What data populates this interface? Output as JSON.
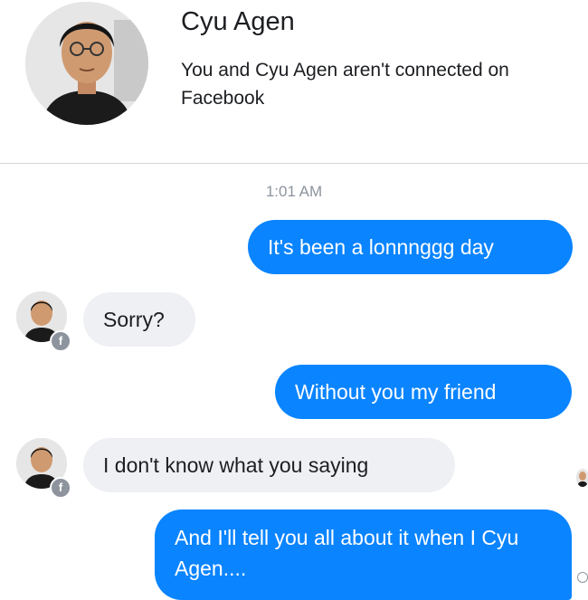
{
  "header": {
    "name": "Cyu Agen",
    "subtitle": "You and Cyu Agen aren't connected on Facebook"
  },
  "conversation": {
    "timestamp": "1:01 AM",
    "messages": [
      {
        "direction": "outgoing",
        "text": "It's been a lonnnggg day"
      },
      {
        "direction": "incoming",
        "text": "Sorry?"
      },
      {
        "direction": "outgoing",
        "text": "Without you my friend"
      },
      {
        "direction": "incoming",
        "text": "I don't know what you saying"
      },
      {
        "direction": "outgoing",
        "text": "And I'll tell you all about it when I Cyu Agen...."
      }
    ]
  },
  "icons": {
    "avatar": "user-photo-icon",
    "badge": "facebook-badge-icon",
    "badge_glyph": "f",
    "seen": "seen-check-icon"
  },
  "colors": {
    "outgoing_bubble": "#0a84ff",
    "incoming_bubble": "#eef0f3",
    "timestamp": "#8d949e"
  }
}
